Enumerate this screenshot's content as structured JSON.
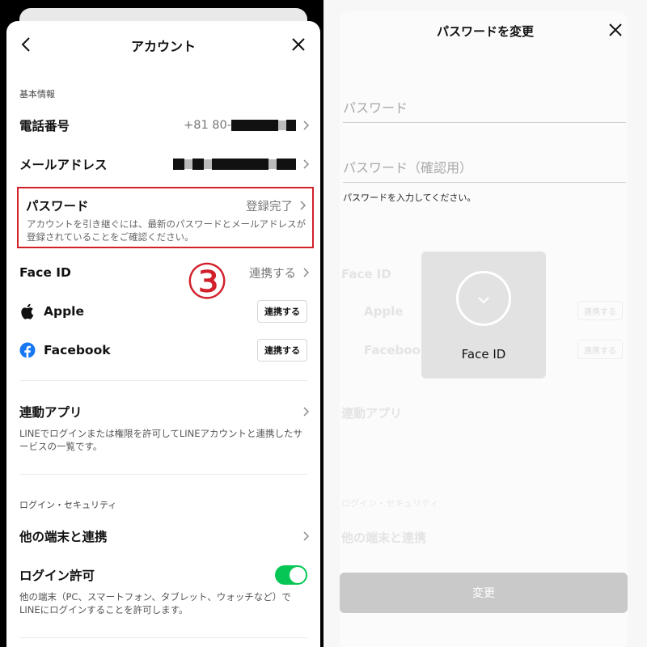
{
  "left": {
    "header": {
      "title": "アカウント"
    },
    "basic_info": {
      "section_label": "基本情報",
      "phone": {
        "label": "電話番号",
        "value": "+81 80-"
      },
      "email": {
        "label": "メールアドレス"
      },
      "password": {
        "label": "パスワード",
        "value": "登録完了",
        "description": "アカウントを引き継ぐには、最新のパスワードとメールアドレスが登録されていることをご確認ください。"
      },
      "face_id": {
        "label": "Face ID",
        "value": "連携する"
      },
      "apple": {
        "label": "Apple",
        "button": "連携する"
      },
      "facebook": {
        "label": "Facebook",
        "button": "連携する"
      }
    },
    "annotation": "③",
    "linked_apps": {
      "label": "連動アプリ",
      "description": "LINEでログインまたは権限を許可してLINEアカウントと連携したサービスの一覧です。"
    },
    "login_security": {
      "section_label": "ログイン・セキュリティ",
      "other_devices": {
        "label": "他の端末と連携"
      },
      "login_permission": {
        "label": "ログイン許可",
        "enabled": true,
        "description": "他の端末（PC、スマートフォン、タブレット、ウォッチなど）でLINEにログインすることを許可します。"
      }
    }
  },
  "right": {
    "header": {
      "title": "パスワードを変更"
    },
    "password_field": {
      "placeholder": "パスワード"
    },
    "confirm_field": {
      "placeholder": "パスワード（確認用）"
    },
    "hint": "パスワードを入力してください。",
    "face_id_overlay": {
      "label": "Face ID"
    },
    "change_button": "変更"
  },
  "colors": {
    "highlight_red": "#d2202a",
    "toggle_green": "#06c755",
    "facebook_blue": "#1877f2"
  }
}
